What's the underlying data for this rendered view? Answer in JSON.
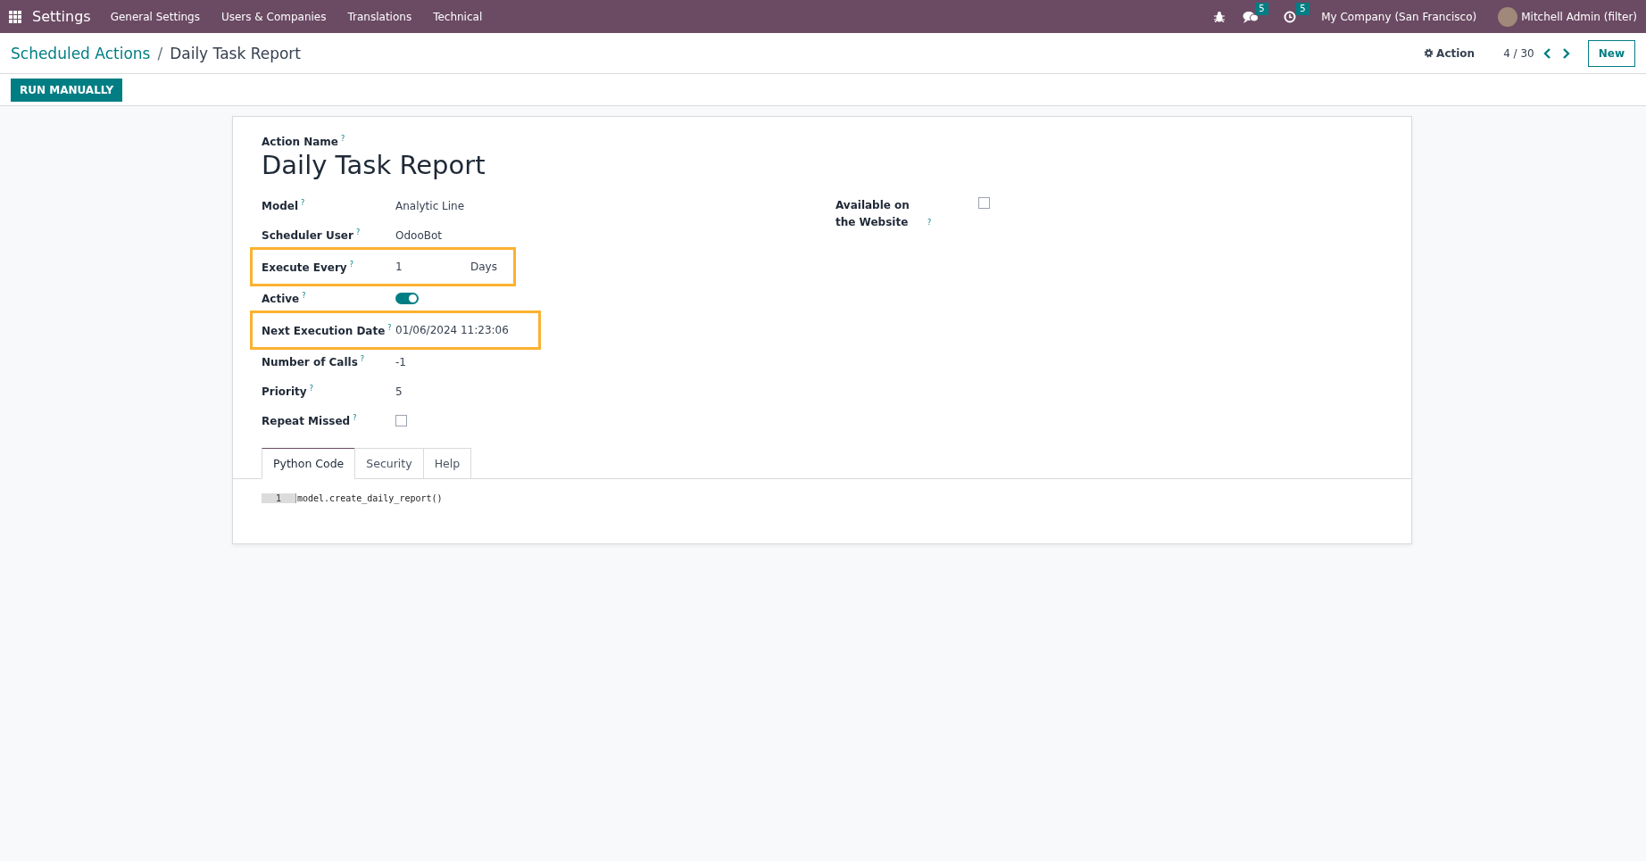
{
  "navbar": {
    "app_name": "Settings",
    "menu": [
      "General Settings",
      "Users & Companies",
      "Translations",
      "Technical"
    ],
    "messages_count": "5",
    "activities_count": "5",
    "company": "My Company (San Francisco)",
    "user": "Mitchell Admin (filter)"
  },
  "breadcrumb": {
    "separator": "/",
    "items": [
      {
        "label": "Scheduled Actions",
        "link": true
      },
      {
        "label": "Daily Task Report",
        "link": false
      }
    ]
  },
  "control_panel": {
    "action": "Action",
    "pager": "4 / 30",
    "new_button": "New"
  },
  "status_buttons": [
    "RUN MANUALLY"
  ],
  "form": {
    "name_label": "Action Name",
    "help_mark": "?",
    "name": "Daily Task Report",
    "left_fields": [
      {
        "kind": "text",
        "label": "Model",
        "value": "Analytic Line",
        "highlighted": false
      },
      {
        "kind": "text",
        "label": "Scheduler User",
        "value": "OdooBot",
        "highlighted": false
      },
      {
        "kind": "interval",
        "label": "Execute Every",
        "value": "1",
        "unit": "Days",
        "highlighted": true
      },
      {
        "kind": "toggle",
        "label": "Active",
        "on": true,
        "highlighted": false
      },
      {
        "kind": "text",
        "label": "Next Execution Date",
        "value": "01/06/2024 11:23:06",
        "highlighted": true
      },
      {
        "kind": "text",
        "label": "Number of Calls",
        "value": "-1",
        "highlighted": false
      },
      {
        "kind": "text",
        "label": "Priority",
        "value": "5",
        "highlighted": false
      },
      {
        "kind": "checkbox",
        "label": "Repeat Missed",
        "checked": false,
        "highlighted": false
      }
    ],
    "right_fields": [
      {
        "kind": "checkbox",
        "label": "Available on the Website",
        "checked": false,
        "highlighted": false
      }
    ],
    "tabs": [
      {
        "label": "Python Code",
        "selected": true
      },
      {
        "label": "Security",
        "selected": false
      },
      {
        "label": "Help",
        "selected": false
      }
    ],
    "code_lines": [
      {
        "number": "1",
        "text": "model.create_daily_report()"
      }
    ]
  }
}
